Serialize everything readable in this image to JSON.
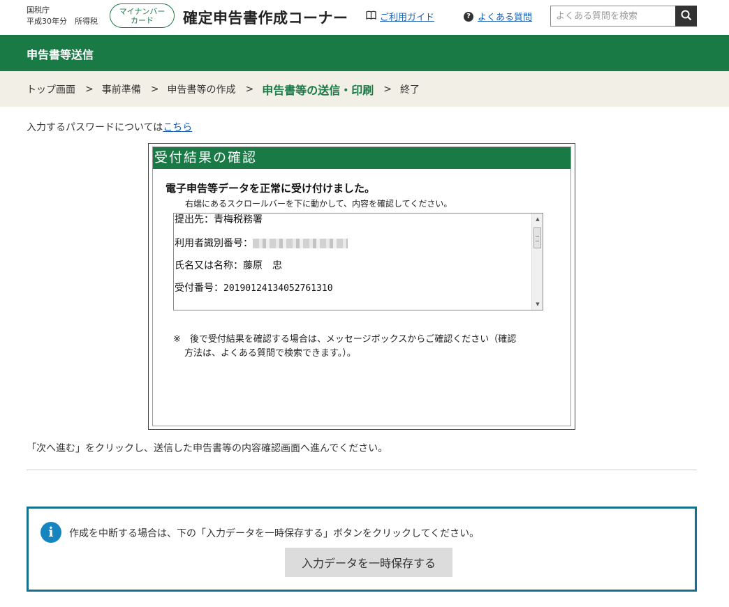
{
  "header": {
    "org_name": "国税庁",
    "org_sub": "平成30年分　所得税",
    "mynumber_line1": "マイナンバー",
    "mynumber_line2": "カード",
    "site_title": "確定申告書作成コーナー",
    "guide_label": "ご利用ガイド",
    "faq_label": "よくある質問",
    "search_placeholder": "よくある質問を検索"
  },
  "page": {
    "title": "申告書等送信"
  },
  "breadcrumb": [
    {
      "label": "トップ画面",
      "current": false
    },
    {
      "label": "事前準備",
      "current": false
    },
    {
      "label": "申告書等の作成",
      "current": false
    },
    {
      "label": "申告書等の送信・印刷",
      "current": true
    },
    {
      "label": "終了",
      "current": false
    }
  ],
  "password_note": {
    "text": "入力するパスワードについては",
    "link": "こちら"
  },
  "result": {
    "heading": "受付結果の確認",
    "message": "電子申告等データを正常に受け付けました。",
    "instruction": "右端にあるスクロールバーを下に動かして、内容を確認してください。",
    "office_label": "提出先：",
    "office_value": "青梅税務署",
    "user_id_label": "利用者識別番号：",
    "name_label": "氏名又は名称：",
    "name_value": "藤原　忠",
    "receipt_label": "受付番号：",
    "receipt_value": "20190124134052761310",
    "note": "※　後で受付結果を確認する場合は、メッセージボックスからご確認ください（確認方法は、よくある質問で検索できます。）。"
  },
  "next_note": "「次へ進む」をクリックし、送信した申告書等の内容確認画面へ進んでください。",
  "info": {
    "text": "作成を中断する場合は、下の「入力データを一時保存する」ボタンをクリックしてください。",
    "save_button": "入力データを一時保存する"
  },
  "colors": {
    "brand_green": "#1a7a46",
    "breadcrumb_bg": "#f1efe6",
    "info_border": "#13718f",
    "info_icon": "#1585bf"
  }
}
